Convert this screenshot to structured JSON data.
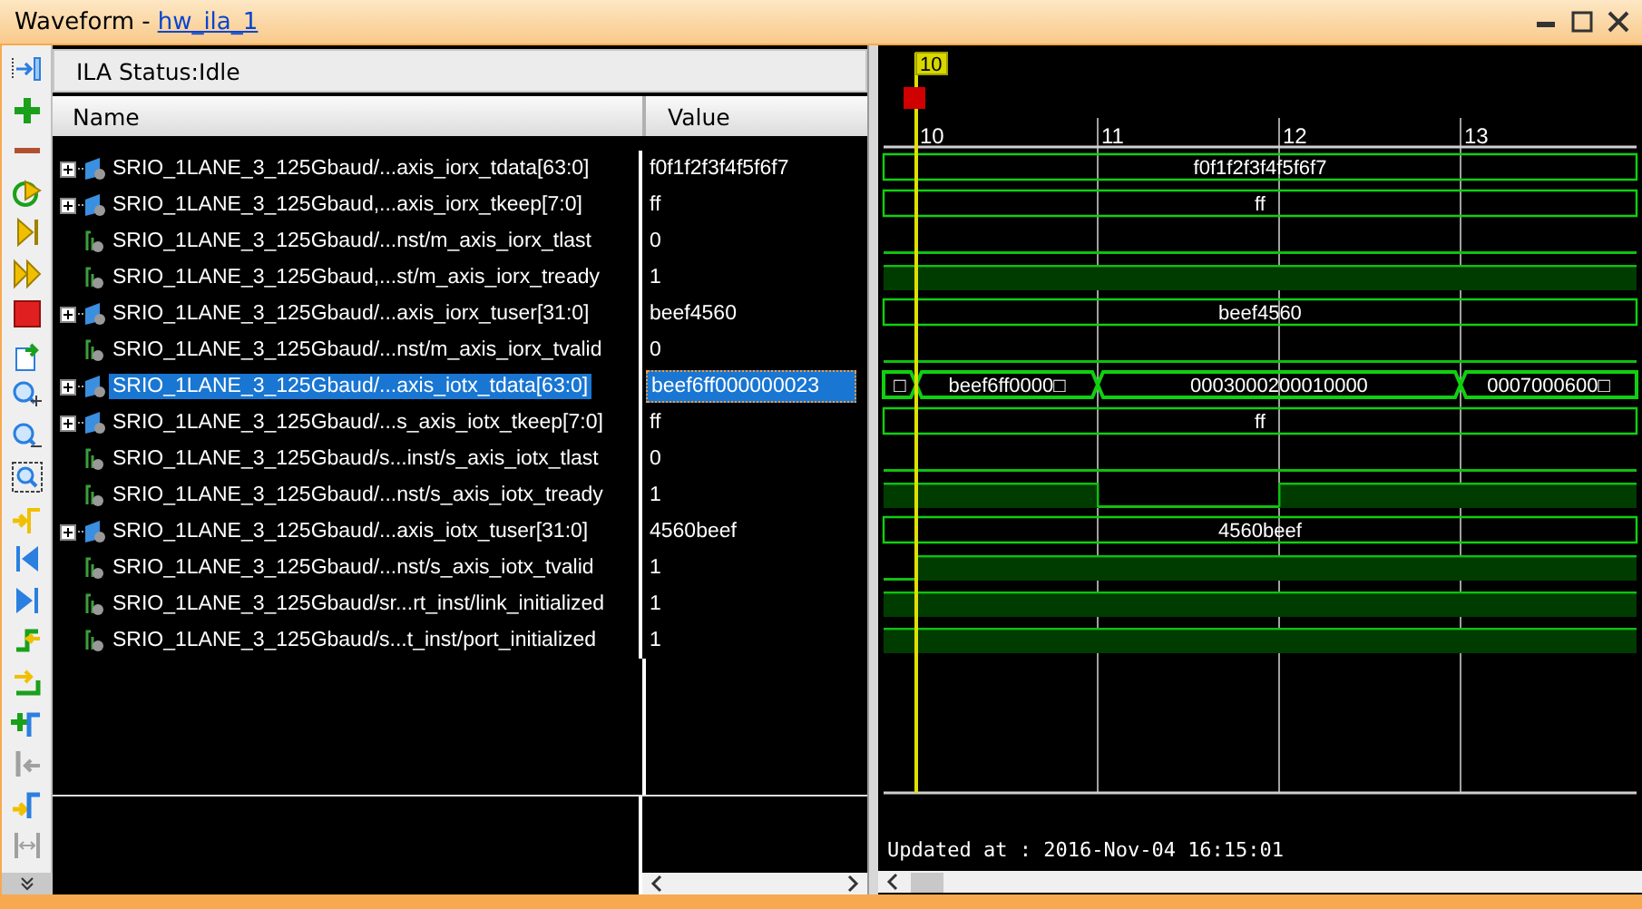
{
  "window": {
    "title": "Waveform -",
    "link": "hw_ila_1"
  },
  "toolbar": [
    {
      "kind": "collapse",
      "disabled": false
    },
    {
      "kind": "add",
      "disabled": false
    },
    {
      "kind": "remove",
      "disabled": false
    },
    {
      "kind": "run-trigger",
      "disabled": false
    },
    {
      "kind": "step",
      "disabled": false
    },
    {
      "kind": "run",
      "disabled": false
    },
    {
      "kind": "stop",
      "disabled": false
    },
    {
      "kind": "export",
      "disabled": false
    },
    {
      "kind": "zoom-in",
      "disabled": false
    },
    {
      "kind": "zoom-out",
      "disabled": false
    },
    {
      "kind": "zoom-fit",
      "disabled": false
    },
    {
      "kind": "go-cursor",
      "disabled": false
    },
    {
      "kind": "go-first",
      "disabled": false
    },
    {
      "kind": "go-last",
      "disabled": false
    },
    {
      "kind": "prev-edge",
      "disabled": false
    },
    {
      "kind": "next-edge",
      "disabled": false
    },
    {
      "kind": "add-marker",
      "disabled": false
    },
    {
      "kind": "prev-marker",
      "disabled": true
    },
    {
      "kind": "next-marker",
      "disabled": false
    },
    {
      "kind": "swap",
      "disabled": true
    }
  ],
  "status": "ILA Status:Idle",
  "columns": [
    "Name",
    "Value"
  ],
  "signals": [
    {
      "kind": "bus",
      "name": "SRIO_1LANE_3_125Gbaud/...axis_iorx_tdata[63:0]",
      "value": "f0f1f2f3f4f5f6f7",
      "selected": false,
      "expanded": false,
      "wave": [
        {
          "label": "f0f1f2f3f4f5f6f7"
        },
        {
          "same": true
        },
        {
          "same": true
        },
        {
          "same": true
        },
        {
          "same": true
        }
      ]
    },
    {
      "kind": "bus",
      "name": "SRIO_1LANE_3_125Gbaud,...axis_iorx_tkeep[7:0]",
      "value": "ff",
      "selected": false,
      "expanded": false,
      "wave": [
        {
          "label": "ff"
        },
        {
          "same": true
        },
        {
          "same": true
        },
        {
          "same": true
        },
        {
          "same": true
        }
      ]
    },
    {
      "kind": "bit",
      "name": "SRIO_1LANE_3_125Gbaud/...nst/m_axis_iorx_tlast",
      "value": "0",
      "selected": false,
      "wave": [
        {
          "high": false
        },
        {
          "high": false
        },
        {
          "high": false
        },
        {
          "high": false
        },
        {
          "high": false
        }
      ]
    },
    {
      "kind": "bit",
      "name": "SRIO_1LANE_3_125Gbaud,...st/m_axis_iorx_tready",
      "value": "1",
      "selected": false,
      "wave": [
        {
          "high": true
        },
        {
          "high": true
        },
        {
          "high": true
        },
        {
          "high": true
        },
        {
          "high": true
        }
      ]
    },
    {
      "kind": "bus",
      "name": "SRIO_1LANE_3_125Gbaud/...axis_iorx_tuser[31:0]",
      "value": "beef4560",
      "selected": false,
      "expanded": false,
      "wave": [
        {
          "label": "beef4560"
        },
        {
          "same": true
        },
        {
          "same": true
        },
        {
          "same": true
        },
        {
          "same": true
        }
      ]
    },
    {
      "kind": "bit",
      "name": "SRIO_1LANE_3_125Gbaud/...nst/m_axis_iorx_tvalid",
      "value": "0",
      "selected": false,
      "wave": [
        {
          "high": false
        },
        {
          "high": false
        },
        {
          "high": false
        },
        {
          "high": false
        },
        {
          "high": false
        }
      ]
    },
    {
      "kind": "bus",
      "name": "SRIO_1LANE_3_125Gbaud/...axis_iotx_tdata[63:0]",
      "value": "beef6ff000000023",
      "selected": true,
      "expanded": false,
      "wave": [
        {
          "label": "□"
        },
        {
          "label": "beef6ff0000□"
        },
        {
          "label": "0003000200010000"
        },
        {
          "same": true
        },
        {
          "label": "0007000600□"
        }
      ]
    },
    {
      "kind": "bus",
      "name": "SRIO_1LANE_3_125Gbaud/...s_axis_iotx_tkeep[7:0]",
      "value": "ff",
      "selected": false,
      "expanded": false,
      "wave": [
        {
          "label": "ff"
        },
        {
          "same": true
        },
        {
          "same": true
        },
        {
          "same": true
        },
        {
          "same": true
        }
      ]
    },
    {
      "kind": "bit",
      "name": "SRIO_1LANE_3_125Gbaud/s...inst/s_axis_iotx_tlast",
      "value": "0",
      "selected": false,
      "wave": [
        {
          "high": false
        },
        {
          "high": false
        },
        {
          "high": false
        },
        {
          "high": false
        },
        {
          "high": false
        }
      ]
    },
    {
      "kind": "bit",
      "name": "SRIO_1LANE_3_125Gbaud/...nst/s_axis_iotx_tready",
      "value": "1",
      "selected": false,
      "wave": [
        {
          "high": true
        },
        {
          "high": true
        },
        {
          "high": false
        },
        {
          "high": true
        },
        {
          "high": true
        }
      ]
    },
    {
      "kind": "bus",
      "name": "SRIO_1LANE_3_125Gbaud/...axis_iotx_tuser[31:0]",
      "value": "4560beef",
      "selected": false,
      "expanded": false,
      "wave": [
        {
          "label": "4560beef"
        },
        {
          "same": true
        },
        {
          "same": true
        },
        {
          "same": true
        },
        {
          "same": true
        }
      ]
    },
    {
      "kind": "bit",
      "name": "SRIO_1LANE_3_125Gbaud/...nst/s_axis_iotx_tvalid",
      "value": "1",
      "selected": false,
      "wave": [
        {
          "high": false
        },
        {
          "high": true
        },
        {
          "high": true
        },
        {
          "high": true
        },
        {
          "high": true
        }
      ]
    },
    {
      "kind": "bit",
      "name": "SRIO_1LANE_3_125Gbaud/sr...rt_inst/link_initialized",
      "value": "1",
      "selected": false,
      "wave": [
        {
          "high": true
        },
        {
          "high": true
        },
        {
          "high": true
        },
        {
          "high": true
        },
        {
          "high": true
        }
      ]
    },
    {
      "kind": "bit",
      "name": "SRIO_1LANE_3_125Gbaud/s...t_inst/port_initialized",
      "value": "1",
      "selected": false,
      "wave": [
        {
          "high": true
        },
        {
          "high": true
        },
        {
          "high": true
        },
        {
          "high": true
        },
        {
          "high": true
        }
      ]
    }
  ],
  "cursor": "10",
  "timeline": [
    "10",
    "11",
    "12",
    "13"
  ],
  "updated": "Updated at : 2016-Nov-04 16:15:01"
}
